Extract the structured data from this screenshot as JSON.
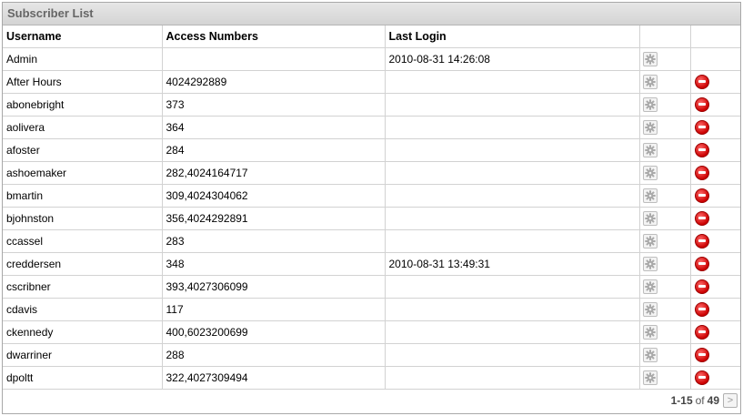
{
  "panel": {
    "title": "Subscriber List"
  },
  "table": {
    "headers": {
      "username": "Username",
      "access": "Access Numbers",
      "login": "Last Login"
    },
    "rows": [
      {
        "username": "Admin",
        "access": "",
        "login": "2010-08-31 14:26:08",
        "deletable": false
      },
      {
        "username": "After Hours",
        "access": "4024292889",
        "login": "",
        "deletable": true
      },
      {
        "username": "abonebright",
        "access": "373",
        "login": "",
        "deletable": true
      },
      {
        "username": "aolivera",
        "access": "364",
        "login": "",
        "deletable": true
      },
      {
        "username": "afoster",
        "access": "284",
        "login": "",
        "deletable": true
      },
      {
        "username": "ashoemaker",
        "access": "282,4024164717",
        "login": "",
        "deletable": true
      },
      {
        "username": "bmartin",
        "access": "309,4024304062",
        "login": "",
        "deletable": true
      },
      {
        "username": "bjohnston",
        "access": "356,4024292891",
        "login": "",
        "deletable": true
      },
      {
        "username": "ccassel",
        "access": "283",
        "login": "",
        "deletable": true
      },
      {
        "username": "creddersen",
        "access": "348",
        "login": "2010-08-31 13:49:31",
        "deletable": true
      },
      {
        "username": "cscribner",
        "access": "393,4027306099",
        "login": "",
        "deletable": true
      },
      {
        "username": "cdavis",
        "access": "117",
        "login": "",
        "deletable": true
      },
      {
        "username": "ckennedy",
        "access": "400,6023200699",
        "login": "",
        "deletable": true
      },
      {
        "username": "dwarriner",
        "access": "288",
        "login": "",
        "deletable": true
      },
      {
        "username": "dpoltt",
        "access": "322,4027309494",
        "login": "",
        "deletable": true
      }
    ]
  },
  "pager": {
    "range": "1-15",
    "of": "of",
    "total": "49",
    "next_symbol": ">"
  },
  "icons": {
    "edit": "gear-icon",
    "delete": "delete-icon"
  },
  "colors": {
    "header_bg": "#d9d9d9",
    "delete_red": "#d40000",
    "grid": "#d2d2d2"
  }
}
